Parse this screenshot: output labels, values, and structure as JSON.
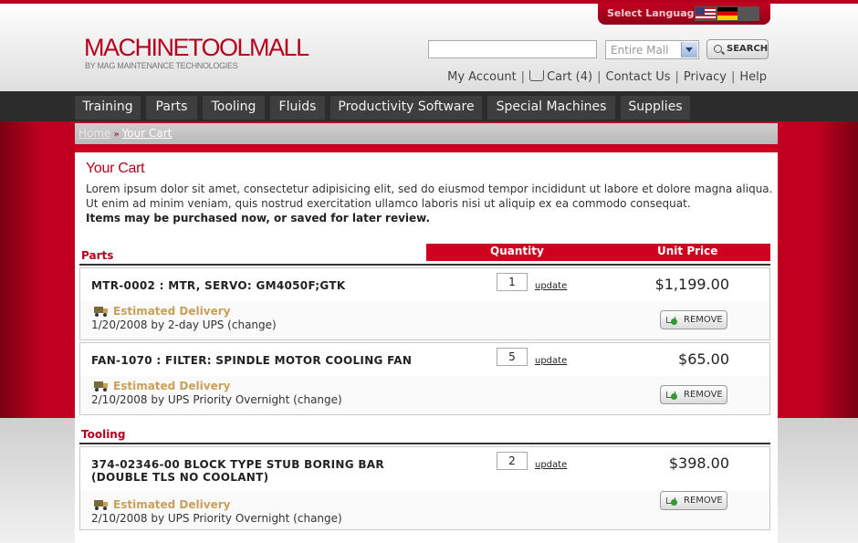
{
  "language": {
    "label": "Select Language",
    "flags": [
      "us-flag-icon",
      "germany-flag-icon",
      "other-flag-icon"
    ]
  },
  "logo": {
    "part1": "MACHINE",
    "part2": "TOOL",
    "part3": "MALL",
    "tagline": "BY MAG MAINTENANCE TECHNOLOGIES"
  },
  "search": {
    "value": "",
    "placeholder": "",
    "scope": "Entire Mall",
    "button": "SEARCH"
  },
  "util_links": {
    "account": "My Account",
    "cart": "Cart (4)",
    "contact": "Contact Us",
    "privacy": "Privacy",
    "help": "Help"
  },
  "nav": [
    "Training",
    "Parts",
    "Tooling",
    "Fluids",
    "Productivity Software",
    "Special Machines",
    "Supplies"
  ],
  "breadcrumb": {
    "home": "Home",
    "current": "Your Cart"
  },
  "page": {
    "title": "Your Cart",
    "intro": "Lorem ipsum dolor sit amet, consectetur adipisicing elit, sed do eiusmod tempor incididunt ut labore et dolore magna aliqua. Ut enim ad minim veniam, quis nostrud exercitation ullamco laboris nisi ut aliquip ex ea commodo consequat.",
    "note": "Items may be purchased now, or saved for later review."
  },
  "columns": {
    "quantity": "Quantity",
    "unit_price": "Unit Price"
  },
  "sections": [
    {
      "label": "Parts",
      "items": [
        {
          "name": "MTR-0002 : MTR, SERVO: GM4050F;GTK",
          "qty": "1",
          "update": "update",
          "price": "$1,199.00",
          "est_label": "Estimated Delivery",
          "delivery": "1/20/2008 by 2-day UPS (change)",
          "remove": "REMOVE"
        },
        {
          "name": "FAN-1070 : FILTER: SPINDLE MOTOR COOLING FAN",
          "qty": "5",
          "update": "update",
          "price": "$65.00",
          "est_label": "Estimated Delivery",
          "delivery": "2/10/2008 by UPS Priority Overnight (change)",
          "remove": "REMOVE"
        }
      ]
    },
    {
      "label": "Tooling",
      "items": [
        {
          "name_line1": "374-02346-00 BLOCK TYPE STUB BORING BAR",
          "name_line2": "(DOUBLE TLS NO COOLANT)",
          "qty": "2",
          "update": "update",
          "price": "$398.00",
          "est_label": "Estimated Delivery",
          "delivery": "2/10/2008 by UPS Priority Overnight (change)",
          "remove": "REMOVE"
        }
      ]
    }
  ],
  "colors": {
    "brand_red": "#b5001d",
    "nav_bg": "#2c2c2c",
    "estimate_gold": "#c8a05a"
  }
}
